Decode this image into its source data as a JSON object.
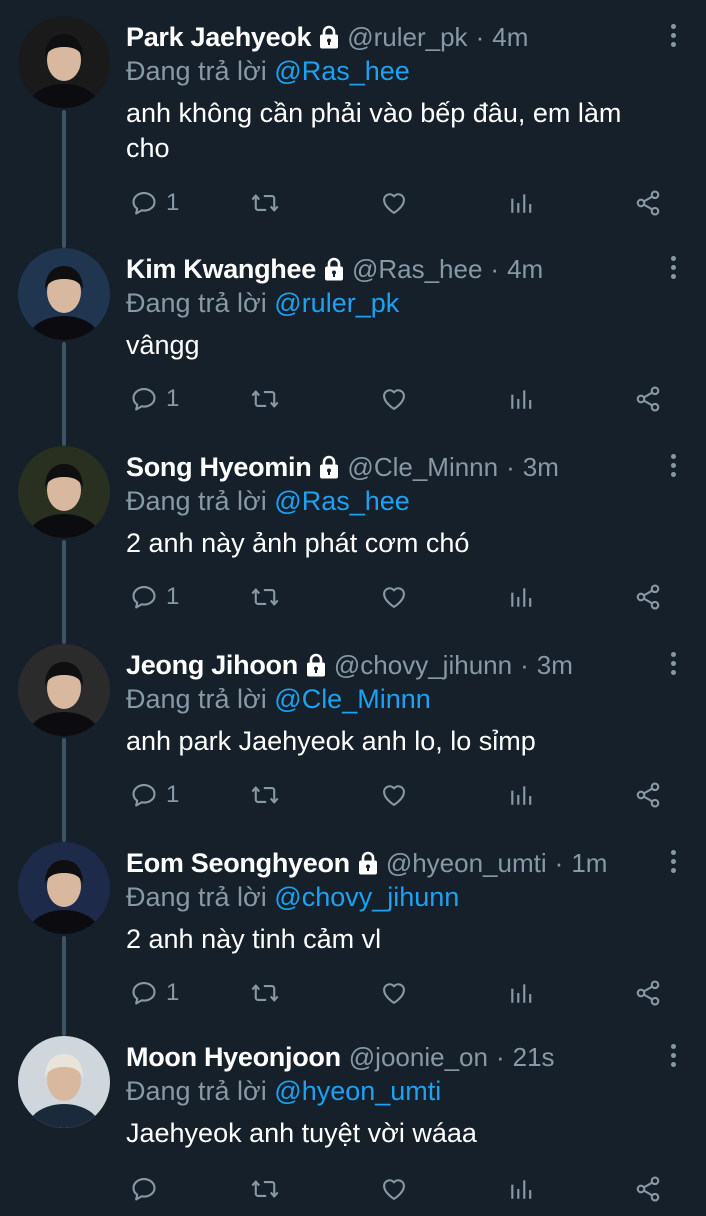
{
  "reply_prefix": "Đang trả lời",
  "tweets": [
    {
      "name": "Park Jaehyeok",
      "handle": "@ruler_pk",
      "time": "4m",
      "reply_to": "@Ras_hee",
      "text": "anh không cần phải vào bếp đâu, em làm cho",
      "replies": "1",
      "locked": true,
      "avatar_color": "#1a1a1a"
    },
    {
      "name": "Kim Kwanghee",
      "handle": "@Ras_hee",
      "time": "4m",
      "reply_to": "@ruler_pk",
      "text": "vângg",
      "replies": "1",
      "locked": true,
      "avatar_color": "#1f3550"
    },
    {
      "name": "Song Hyeomin",
      "handle": "@Cle_Minnn",
      "time": "3m",
      "reply_to": "@Ras_hee",
      "text": "2 anh này ảnh phát cơm chó",
      "replies": "1",
      "locked": true,
      "avatar_color": "#2a3020"
    },
    {
      "name": "Jeong Jihoon",
      "handle": "@chovy_jihunn",
      "time": "3m",
      "reply_to": "@Cle_Minnn",
      "text": "anh park Jaehyeok anh lo, lo sỉmp",
      "replies": "1",
      "locked": true,
      "avatar_color": "#2b2b2b"
    },
    {
      "name": "Eom Seonghyeon",
      "handle": "@hyeon_umti",
      "time": "1m",
      "reply_to": "@chovy_jihunn",
      "text": "2 anh này tinh cảm vl",
      "replies": "1",
      "locked": true,
      "avatar_color": "#1e2a4a"
    },
    {
      "name": "Moon Hyeonjoon",
      "handle": "@joonie_on",
      "time": "21s",
      "reply_to": "@hyeon_umti",
      "text": "Jaehyeok anh tuyệt vời wáaa",
      "replies": "",
      "locked": false,
      "avatar_color": "#cfd6dc"
    }
  ],
  "colors": {
    "background": "#15202b",
    "secondary_text": "#8899a6",
    "accent": "#1da1f2",
    "thread_line": "#3d5466"
  },
  "icons": {
    "reply": "reply-bubble-icon",
    "retweet": "retweet-icon",
    "like": "heart-icon",
    "analytics": "analytics-bars-icon",
    "share": "share-icon",
    "more": "more-vertical-icon",
    "lock": "lock-icon"
  }
}
